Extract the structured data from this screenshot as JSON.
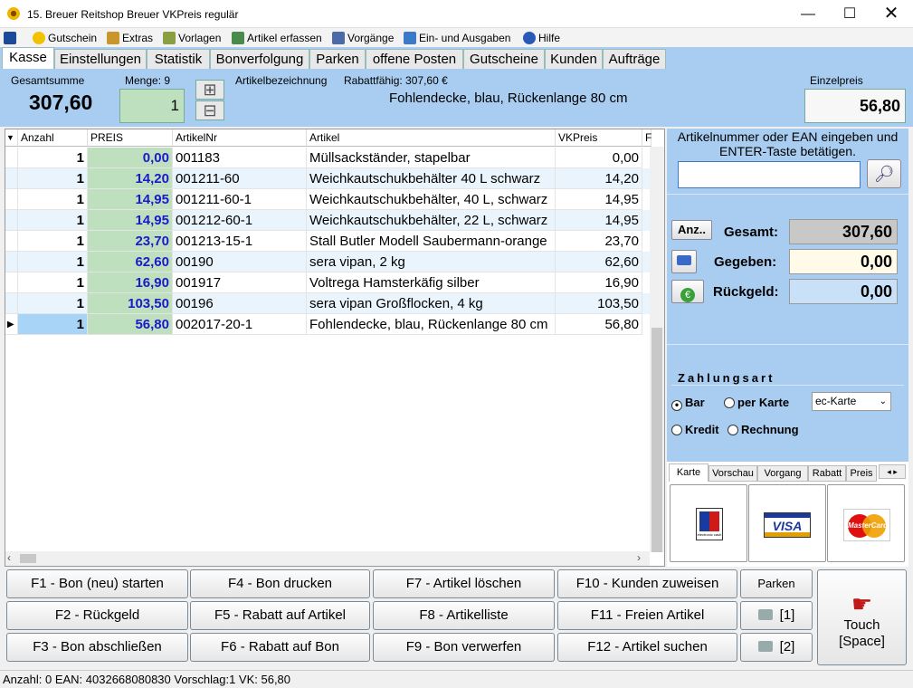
{
  "window": {
    "title": "15. Breuer Reitshop  Breuer   VKPreis regulär"
  },
  "menu": [
    {
      "label": "Gutschein",
      "icon": "smiley-icon",
      "color": "#f2c200"
    },
    {
      "label": "Extras",
      "icon": "tools-icon",
      "color": "#c8962a"
    },
    {
      "label": "Vorlagen",
      "icon": "template-icon",
      "color": "#8aa040"
    },
    {
      "label": "Artikel erfassen",
      "icon": "article-icon",
      "color": "#4a8a4a"
    },
    {
      "label": "Vorgänge",
      "icon": "document-icon",
      "color": "#4a6aa8"
    },
    {
      "label": "Ein- und Ausgaben",
      "icon": "cashflow-icon",
      "color": "#3a7ac8"
    },
    {
      "label": "Hilfe",
      "icon": "help-icon",
      "color": "#2a5ab8"
    }
  ],
  "tabs": [
    "Kasse",
    "Einstellungen",
    "Statistik",
    "Bonverfolgung",
    "Parken",
    "offene Posten",
    "Gutscheine",
    "Kunden",
    "Aufträge"
  ],
  "header": {
    "gesamtsumme_label": "Gesamtsumme",
    "gesamtsumme_value": "307,60",
    "menge_label": "Menge: 9",
    "menge_value": "1",
    "artikel_label": "Artikelbezeichnung",
    "rabatt_label": "Rabattfähig: 307,60 €",
    "artikel_value": "Fohlendecke,  blau,  Rückenlange 80 cm",
    "einzelpreis_label": "Einzelpreis",
    "einzelpreis_value": "56,80"
  },
  "grid": {
    "columns": [
      "Anzahl",
      "PREIS",
      "ArtikelNr",
      "Artikel",
      "VKPreis",
      "F"
    ],
    "rows": [
      {
        "anzahl": "1",
        "preis": "0,00",
        "nr": "001183",
        "artikel": "Müllsackständer, stapelbar",
        "vk": "0,00"
      },
      {
        "anzahl": "1",
        "preis": "14,20",
        "nr": "001211-60",
        "artikel": "Weichkautschukbehälter 40 L schwarz",
        "vk": "14,20"
      },
      {
        "anzahl": "1",
        "preis": "14,95",
        "nr": "001211-60-1",
        "artikel": "Weichkautschukbehälter, 40 L, schwarz",
        "vk": "14,95"
      },
      {
        "anzahl": "1",
        "preis": "14,95",
        "nr": "001212-60-1",
        "artikel": "Weichkautschukbehälter, 22 L, schwarz",
        "vk": "14,95"
      },
      {
        "anzahl": "1",
        "preis": "23,70",
        "nr": "001213-15-1",
        "artikel": "Stall Butler Modell Saubermann-orange",
        "vk": "23,70"
      },
      {
        "anzahl": "1",
        "preis": "62,60",
        "nr": "00190",
        "artikel": "sera vipan, 2 kg",
        "vk": "62,60"
      },
      {
        "anzahl": "1",
        "preis": "16,90",
        "nr": "001917",
        "artikel": "Voltrega Hamsterkäfig silber",
        "vk": "16,90"
      },
      {
        "anzahl": "1",
        "preis": "103,50",
        "nr": "00196",
        "artikel": "sera vipan Großflocken, 4 kg",
        "vk": "103,50"
      },
      {
        "anzahl": "1",
        "preis": "56,80",
        "nr": "002017-20-1",
        "artikel": "Fohlendecke,  blau,  Rückenlange 80 cm",
        "vk": "56,80"
      }
    ]
  },
  "right": {
    "search_hint": "Artikelnummer oder EAN eingeben und ENTER-Taste betätigen.",
    "search_value": "",
    "anz_label": "Anz..",
    "gesamt_label": "Gesamt:",
    "gesamt_value": "307,60",
    "gegeben_label": "Gegeben:",
    "gegeben_value": "0,00",
    "rueckgeld_label": "Rückgeld:",
    "rueckgeld_value": "0,00",
    "zahlungsart_label": "Zahlungsart",
    "bar": "Bar",
    "per_karte": "per Karte",
    "karte_select": "ec-Karte",
    "kredit": "Kredit",
    "rechnung": "Rechnung",
    "subtabs": [
      "Karte",
      "Vorschau",
      "Vorgang",
      "Rabatt",
      "Preis"
    ],
    "card_logos": {
      "ec": "electronic cash",
      "visa": "VISA",
      "mastercard": "MasterCard"
    }
  },
  "buttons": {
    "f1": "F1 - Bon (neu) starten",
    "f2": "F2 - Rückgeld",
    "f3": "F3 - Bon abschließen",
    "f4": "F4 - Bon drucken",
    "f5": "F5 - Rabatt auf Artikel",
    "f6": "F6 - Rabatt auf Bon",
    "f7": "F7 - Artikel löschen",
    "f8": "F8 - Artikelliste",
    "f9": "F9 - Bon verwerfen",
    "f10": "F10 - Kunden zuweisen",
    "f11": "F11 - Freien Artikel",
    "f12": "F12 - Artikel suchen",
    "parken": "Parken",
    "print1": "[1]",
    "print2": "[2]",
    "touch": "Touch",
    "touch2": "[Space]"
  },
  "status": "Anzahl: 0  EAN: 4032668080830  Vorschlag:1  VK: 56,80",
  "colors": {
    "header_bg": "#a9cdf0",
    "price_cell": "#bfe0bf",
    "price_text": "#1a1acc",
    "highlight_row": "#eaf4fc"
  }
}
